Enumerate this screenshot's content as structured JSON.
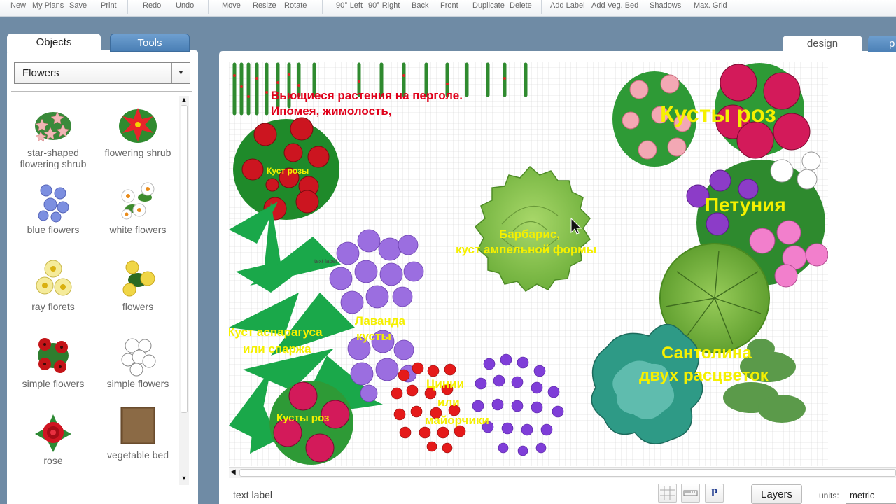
{
  "toolbar": {
    "items": [
      "New",
      "My Plans",
      "Save",
      "Print",
      "Redo",
      "Undo",
      "Move",
      "Resize",
      "Rotate",
      "90° Left",
      "90° Right",
      "Back",
      "Front",
      "Duplicate",
      "Delete",
      "Add Label",
      "Add Veg. Bed",
      "Shadows",
      "Max. Grid"
    ]
  },
  "left_panel": {
    "tab_objects": "Objects",
    "tab_tools": "Tools",
    "category": "Flowers",
    "items": [
      {
        "label": "star-shaped flowering shrub",
        "icon": "star-shaped-shrub-icon"
      },
      {
        "label": "flowering shrub",
        "icon": "flowering-shrub-icon"
      },
      {
        "label": "blue flowers",
        "icon": "blue-flowers-icon"
      },
      {
        "label": "white flowers",
        "icon": "white-flowers-icon"
      },
      {
        "label": "ray florets",
        "icon": "ray-florets-icon"
      },
      {
        "label": "flowers",
        "icon": "yellow-flowers-icon"
      },
      {
        "label": "simple flowers",
        "icon": "red-simple-flowers-icon"
      },
      {
        "label": "simple flowers",
        "icon": "white-simple-flowers-icon"
      },
      {
        "label": "rose",
        "icon": "rose-icon"
      },
      {
        "label": "vegetable bed",
        "icon": "vegetable-bed-icon"
      }
    ]
  },
  "design": {
    "tab_design": "design",
    "tab_other": "p",
    "labels": {
      "pergola": "Вьющиеся растения на перголе.",
      "pergola2": "Ипомея, жимолость,",
      "rose_bush_small": "Куст розы",
      "rose_bushes_top": "Кусты роз",
      "petunia": "Петуния",
      "barberry1": "Барбарис,",
      "barberry2": "куст ампельной формы",
      "text_label": "text label",
      "lavender1": "Лаванда",
      "lavender2": "кусты",
      "asparagus1": "Куст аспарагуса",
      "asparagus2": "или спаржа",
      "santolina1": "Сантолина",
      "santolina2": "двух расцветок",
      "zinnia1": "Цинии",
      "zinnia2": "или",
      "zinnia3": "майорчики",
      "rose_bushes_bottom": "Кусты роз"
    },
    "colors": {
      "label_yellow": "#f5f000",
      "label_red": "#e0001a"
    }
  },
  "status": {
    "label": "text label",
    "layers": "Layers",
    "units_label": "units:",
    "units_value": "metric",
    "p_button": "P"
  }
}
